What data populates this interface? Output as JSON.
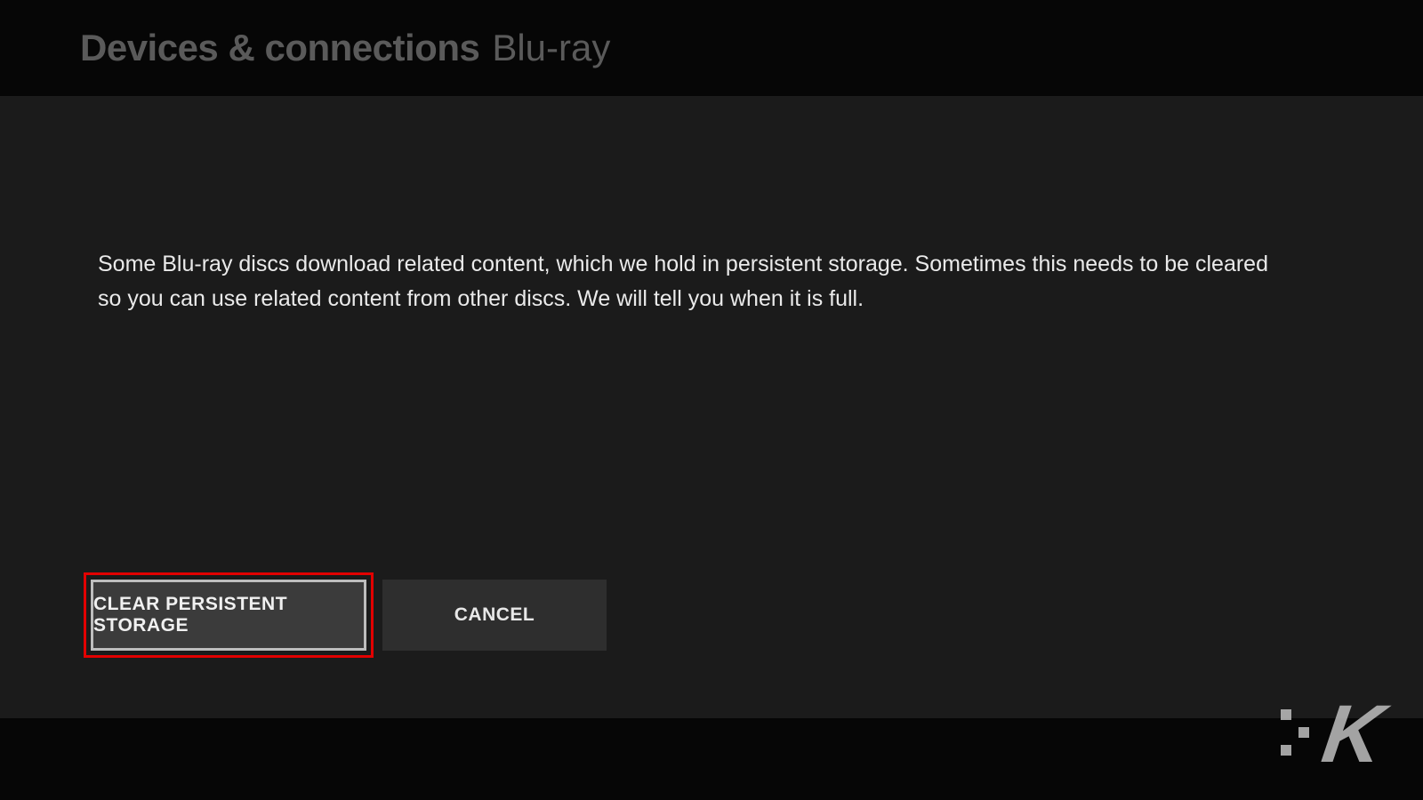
{
  "header": {
    "title": "Devices & connections",
    "subtitle": "Blu-ray"
  },
  "main": {
    "description": "Some Blu-ray discs download related content, which we hold in persistent storage.  Sometimes this needs to be cleared so you can use related content from other discs. We will tell you when it is full."
  },
  "buttons": {
    "primary": "CLEAR PERSISTENT STORAGE",
    "secondary": "CANCEL"
  },
  "watermark": {
    "letter": "K"
  }
}
